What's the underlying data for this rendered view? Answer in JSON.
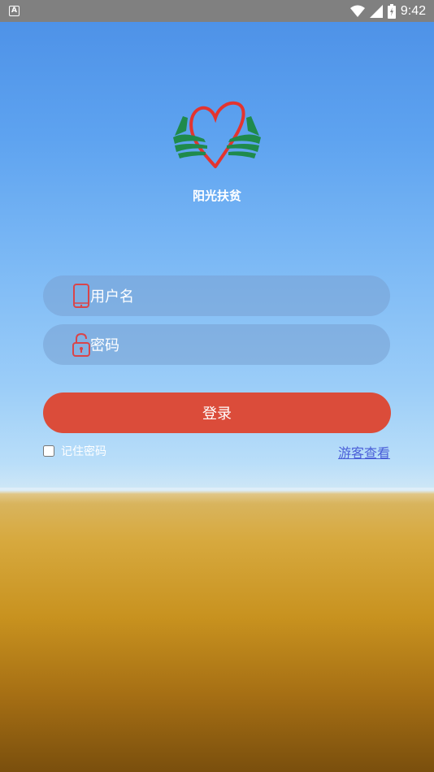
{
  "status_bar": {
    "time": "9:42"
  },
  "app": {
    "title": "阳光扶贫"
  },
  "form": {
    "username_placeholder": "用户名",
    "password_placeholder": "密码",
    "login_label": "登录",
    "remember_label": "记住密码",
    "remember_checked": false,
    "guest_label": "游客查看"
  },
  "icons": {
    "phone": "phone-icon",
    "lock": "lock-icon",
    "logo": "heart-hands-logo"
  },
  "colors": {
    "login_button": "#db4c3a",
    "guest_link": "#4a5fd8",
    "field_icon": "#d9454a"
  }
}
